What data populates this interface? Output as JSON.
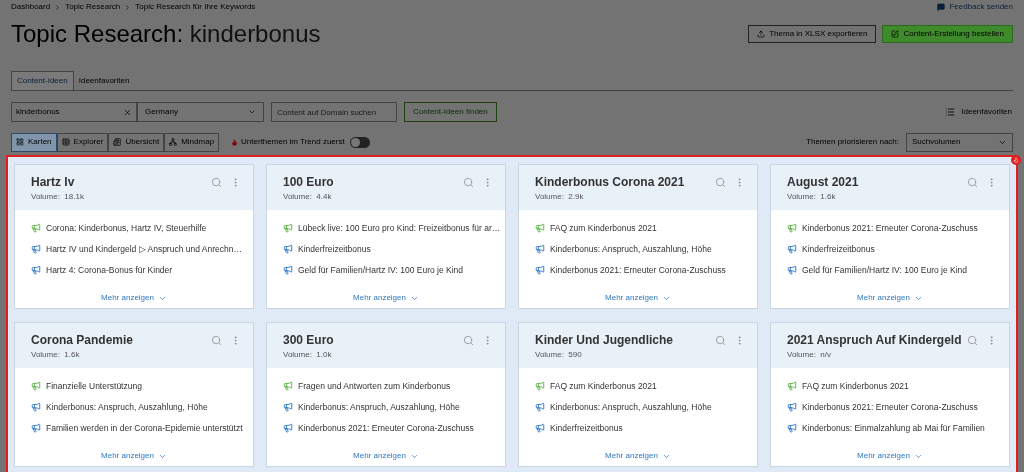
{
  "breadcrumbs": [
    "Dashboard",
    "Topic Research",
    "Topic Research für Ihre Keywords"
  ],
  "feedback": "Feedback senden",
  "title": {
    "prefix": "Topic Research:",
    "keyword": "kinderbonus"
  },
  "header_buttons": [
    {
      "label": "Thema in XLSX exportieren",
      "kind": "outline"
    },
    {
      "label": "Content-Erstellung bestellen",
      "kind": "primary"
    }
  ],
  "tabs": [
    {
      "label": "Content-Ideen",
      "selected": true
    },
    {
      "label": "Ideenfavoriten",
      "selected": false
    }
  ],
  "search": {
    "value": "kinderbonus",
    "country": "Germany",
    "domain_placeholder": "Content auf Domain suchen",
    "button": "Content-Ideen finden",
    "favorites": "Ideenfavoriten"
  },
  "views": [
    {
      "label": "Karten",
      "selected": true
    },
    {
      "label": "Explorer",
      "selected": false
    },
    {
      "label": "Übersicht",
      "selected": false
    },
    {
      "label": "Mindmap",
      "selected": false
    }
  ],
  "trend_toggle": {
    "label": "Unterthemen im Trend zuerst",
    "on": false
  },
  "priority": {
    "label": "Themen priorisieren nach:",
    "value": "Suchvolumen"
  },
  "cards": [
    {
      "title": "Hartz Iv",
      "volume": "Volume:  18.1k",
      "more": "Mehr anzeigen",
      "headlines": [
        {
          "text": "Corona: Kinderbonus, Hartz IV, Steuerhilfe",
          "kind": "trending"
        },
        {
          "text": "Hartz IV und Kindergeld ▷ Anspruch und Anrechn…",
          "kind": "regular"
        },
        {
          "text": "Hartz 4: Corona-Bonus für Kinder",
          "kind": "regular"
        }
      ]
    },
    {
      "title": "100 Euro",
      "volume": "Volume:  4.4k",
      "more": "Mehr anzeigen",
      "headlines": [
        {
          "text": "Lübeck live: 100 Euro pro Kind: Freizeitbonus für ar…",
          "kind": "trending"
        },
        {
          "text": "Kinderfreizeitbonus",
          "kind": "regular"
        },
        {
          "text": "Geld für Familien/Hartz IV: 100 Euro je Kind",
          "kind": "regular"
        }
      ]
    },
    {
      "title": "Kinderbonus Corona 2021",
      "volume": "Volume:  2.9k",
      "more": "Mehr anzeigen",
      "headlines": [
        {
          "text": "FAQ zum Kinderbonus 2021",
          "kind": "trending"
        },
        {
          "text": "Kinderbonus: Anspruch, Auszahlung, Höhe",
          "kind": "regular"
        },
        {
          "text": "Kinderbonus 2021: Erneuter Corona-Zuschuss",
          "kind": "regular"
        }
      ]
    },
    {
      "title": "August 2021",
      "volume": "Volume:  1.6k",
      "more": "Mehr anzeigen",
      "headlines": [
        {
          "text": "Kinderbonus 2021: Erneuter Corona-Zuschuss",
          "kind": "trending"
        },
        {
          "text": "Kinderfreizeitbonus",
          "kind": "regular"
        },
        {
          "text": "Geld für Familien/Hartz IV: 100 Euro je Kind",
          "kind": "regular"
        }
      ]
    },
    {
      "title": "Corona Pandemie",
      "volume": "Volume:  1.6k",
      "more": "Mehr anzeigen",
      "headlines": [
        {
          "text": "Finanzielle Unterstützung",
          "kind": "trending"
        },
        {
          "text": "Kinderbonus: Anspruch, Auszahlung, Höhe",
          "kind": "regular"
        },
        {
          "text": "Familien werden in der Corona-Epidemie unterstützt",
          "kind": "regular"
        }
      ]
    },
    {
      "title": "300 Euro",
      "volume": "Volume:  1.0k",
      "more": "Mehr anzeigen",
      "headlines": [
        {
          "text": "Fragen und Antworten zum Kinderbonus",
          "kind": "trending"
        },
        {
          "text": "Kinderbonus: Anspruch, Auszahlung, Höhe",
          "kind": "regular"
        },
        {
          "text": "Kinderbonus 2021: Erneuter Corona-Zuschuss",
          "kind": "regular"
        }
      ]
    },
    {
      "title": "Kinder Und Jugendliche",
      "volume": "Volume:  590",
      "more": "Mehr anzeigen",
      "headlines": [
        {
          "text": "FAQ zum Kinderbonus 2021",
          "kind": "trending"
        },
        {
          "text": "Kinderbonus: Anspruch, Auszahlung, Höhe",
          "kind": "regular"
        },
        {
          "text": "Kinderfreizeitbonus",
          "kind": "regular"
        }
      ]
    },
    {
      "title": "2021 Anspruch Auf Kindergeld",
      "volume": "Volume:  n/v",
      "more": "Mehr anzeigen",
      "headlines": [
        {
          "text": "FAQ zum Kinderbonus 2021",
          "kind": "trending"
        },
        {
          "text": "Kinderbonus 2021: Erneuter Corona-Zuschuss",
          "kind": "regular"
        },
        {
          "text": "Kinderbonus: Einmalzahlung ab Mai für Familien",
          "kind": "regular"
        }
      ]
    }
  ]
}
